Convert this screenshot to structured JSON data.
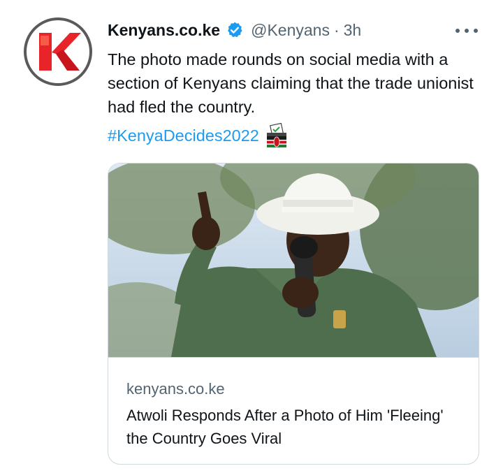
{
  "tweet": {
    "author_name": "Kenyans.co.ke",
    "verified": true,
    "handle": "@Kenyans",
    "separator": "·",
    "time": "3h",
    "text": "The photo made rounds on social media with a section of Kenyans claiming that the trade unionist had fled the country.",
    "hashtag": "#KenyaDecides2022",
    "emoji": "ballot-box-with-kenya-flag"
  },
  "card": {
    "domain": "kenyans.co.ke",
    "title": "Atwoli Responds After a Photo of Him 'Fleeing' the Country Goes Viral",
    "image": "man in green shirt and white hat speaking into a microphone"
  },
  "colors": {
    "text": "#0f1419",
    "secondary": "#536471",
    "accent": "#1d9bf0",
    "border": "#cfd9de",
    "brand_red": "#e8232a"
  }
}
